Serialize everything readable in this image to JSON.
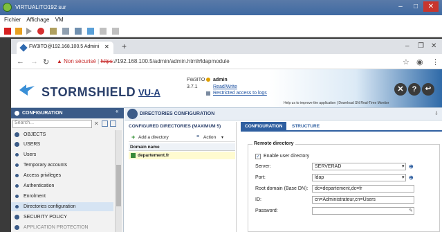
{
  "vm": {
    "title": "VIRTUALITO192 sur",
    "menu": [
      "Fichier",
      "Affichage",
      "VM"
    ]
  },
  "browser": {
    "tab_title": "FW3ITO@192.168.100.5 Admini",
    "new_tab": "+",
    "insecure_label": "Non sécurisé",
    "url_scheme": "https",
    "url_rest": "://192.168.100.5/admin/admin.html#ldapmodule"
  },
  "header": {
    "brand": "STORMSHIELD",
    "model": "VU-A",
    "host": "FW3ITO",
    "version": "3.7.1",
    "user": "admin",
    "rw": "Read/Write",
    "restricted": "Restricted access to logs",
    "help_text": "Help us to improve the application  |  Download SN Real-Time Monitor"
  },
  "left": {
    "section": "CONFIGURATION",
    "search_placeholder": "Search...",
    "items": [
      {
        "label": "OBJECTS",
        "type": "top"
      },
      {
        "label": "USERS",
        "type": "top"
      },
      {
        "label": "Users",
        "type": "sub"
      },
      {
        "label": "Temporary accounts",
        "type": "sub"
      },
      {
        "label": "Access privileges",
        "type": "sub"
      },
      {
        "label": "Authentication",
        "type": "sub"
      },
      {
        "label": "Enrolment",
        "type": "sub"
      },
      {
        "label": "Directories configuration",
        "type": "sub",
        "selected": true
      },
      {
        "label": "SECURITY POLICY",
        "type": "top"
      },
      {
        "label": "APPLICATION PROTECTION",
        "type": "top"
      }
    ]
  },
  "main": {
    "title": "DIRECTORIES CONFIGURATION",
    "list_title": "CONFIGURED DIRECTORIES (MAXIMUM 5)",
    "add_label": "Add a directory",
    "action_label": "Action",
    "col_header": "Domain name",
    "domains": [
      "departement.fr"
    ],
    "tabs": [
      "CONFIGURATION",
      "STRUCTURE"
    ],
    "group_title": "Remote directory",
    "enable_label": "Enable user directory",
    "fields": [
      {
        "label": "Server:",
        "value": "SERVERAD"
      },
      {
        "label": "Port:",
        "value": "ldap"
      },
      {
        "label": "Root domain (Base DN):",
        "value": "dc=departement,dc=fr"
      },
      {
        "label": "ID:",
        "value": "cn=Administrateur,cn=Users"
      },
      {
        "label": "Password:",
        "value": ""
      }
    ]
  },
  "colors": {
    "nav_dark": "#3b5b88",
    "accent": "#2f5fa0",
    "selected_row": "#fffbd0",
    "insecure": "#c62828"
  }
}
